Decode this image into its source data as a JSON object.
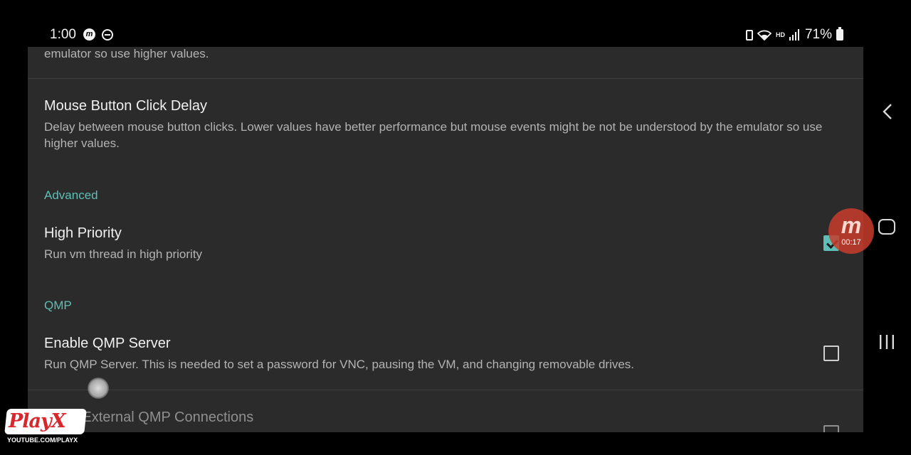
{
  "status_bar": {
    "time": "1:00",
    "notification_icons": [
      "m-app-icon",
      "do-not-disturb-icon"
    ],
    "right_icons": [
      "battery-alert-icon",
      "wifi-icon",
      "hd-voice-icon",
      "signal-icon"
    ],
    "hd_label": "HD",
    "battery_percent": "71%"
  },
  "settings": {
    "partial_top_summary": "emulator so use higher values.",
    "items": [
      {
        "title": "Mouse Button Click Delay",
        "summary": "Delay between mouse button clicks. Lower values have better performance but mouse events might be not be understood by the emulator so use higher values."
      }
    ],
    "categories": {
      "advanced": "Advanced",
      "qmp": "QMP"
    },
    "high_priority": {
      "title": "High Priority",
      "summary": "Run vm thread in high priority",
      "checked": true
    },
    "enable_qmp": {
      "title": "Enable QMP Server",
      "summary": "Run QMP Server. This is needed to set a password for VNC, pausing the VM, and changing removable drives.",
      "checked": false
    },
    "partial_bottom_title": "Allow External QMP Connections"
  },
  "recorder_overlay": {
    "logo": "m",
    "elapsed": "00:17"
  },
  "navigation": [
    "back-icon",
    "home-icon",
    "recents-icon"
  ],
  "watermark": {
    "logo_text": "PlayX",
    "url": "YOUTUBE.COM/PLAYX"
  },
  "colors": {
    "accent": "#5fbfb6",
    "panel_bg": "#2b2b2b",
    "screen_bg": "#000000",
    "recorder": "#c83c2d"
  }
}
